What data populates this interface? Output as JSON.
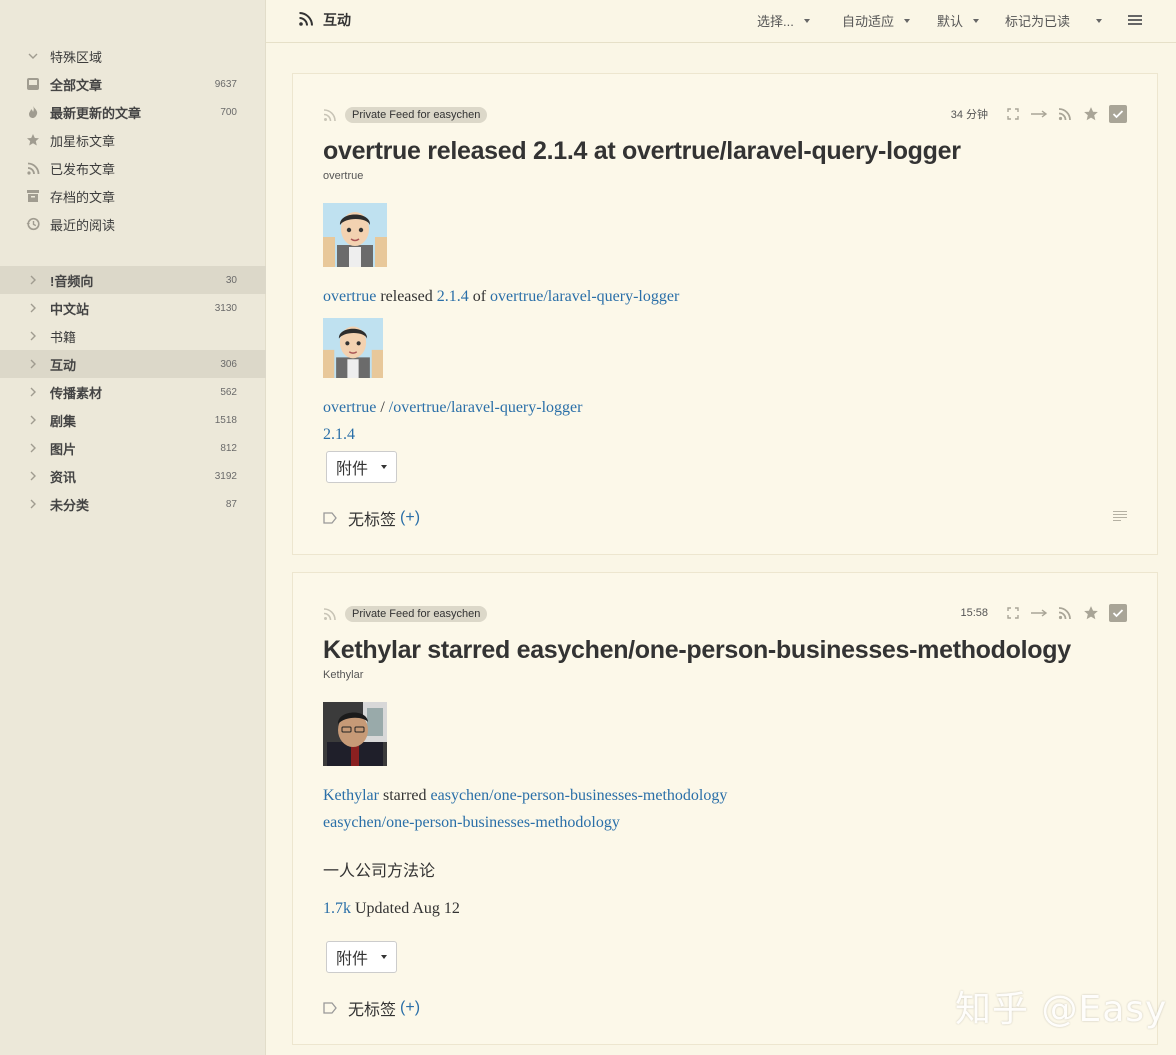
{
  "sidebar": {
    "special": [
      {
        "label": "特殊区域",
        "count": "",
        "icon": "chevron-down-icon"
      },
      {
        "label": "全部文章",
        "count": "9637",
        "icon": "inbox-icon"
      },
      {
        "label": "最新更新的文章",
        "count": "700",
        "icon": "flame-icon"
      },
      {
        "label": "加星标文章",
        "count": "",
        "icon": "star-icon"
      },
      {
        "label": "已发布文章",
        "count": "",
        "icon": "rss-icon"
      },
      {
        "label": "存档的文章",
        "count": "",
        "icon": "archive-icon"
      },
      {
        "label": "最近的阅读",
        "count": "",
        "icon": "history-icon"
      }
    ],
    "categories": [
      {
        "label": "!音频向",
        "count": "30"
      },
      {
        "label": "中文站",
        "count": "3130"
      },
      {
        "label": "书籍",
        "count": ""
      },
      {
        "label": "互动",
        "count": "306"
      },
      {
        "label": "传播素材",
        "count": "562"
      },
      {
        "label": "剧集",
        "count": "1518"
      },
      {
        "label": "图片",
        "count": "812"
      },
      {
        "label": "资讯",
        "count": "3192"
      },
      {
        "label": "未分类",
        "count": "87"
      }
    ]
  },
  "topbar": {
    "title": "互动",
    "select_label": "选择...",
    "adapt_label": "自动适应",
    "default_label": "默认",
    "mark_read_label": "标记为已读"
  },
  "articles": [
    {
      "feed": "Private Feed for easychen",
      "time": "34 分钟",
      "title": "overtrue released 2.1.4 at overtrue/laravel-query-logger",
      "author": "overtrue",
      "line1_user": "overtrue",
      "line1_mid": " released ",
      "line1_version": "2.1.4",
      "line1_of": " of ",
      "line1_repo": "overtrue/laravel-query-logger",
      "line2_user": "overtrue",
      "line2_sep": " / ",
      "line2_repo": "/overtrue/laravel-query-logger",
      "line3_version": "2.1.4",
      "attach_label": "附件",
      "tags_label": "无标签",
      "tags_add": "(+)"
    },
    {
      "feed": "Private Feed for easychen",
      "time": "15:58",
      "title": "Kethylar starred easychen/one-person-businesses-methodology",
      "author": "Kethylar",
      "line1_user": "Kethylar",
      "line1_mid": " starred ",
      "line1_repo": "easychen/one-person-businesses-methodology",
      "line2_repo": "easychen/one-person-businesses-methodology",
      "desc": "一人公司方法论",
      "stars": "1.7k",
      "updated": " Updated Aug 12",
      "attach_label": "附件",
      "tags_label": "无标签",
      "tags_add": "(+)"
    }
  ],
  "watermark": "知乎 @Easy"
}
